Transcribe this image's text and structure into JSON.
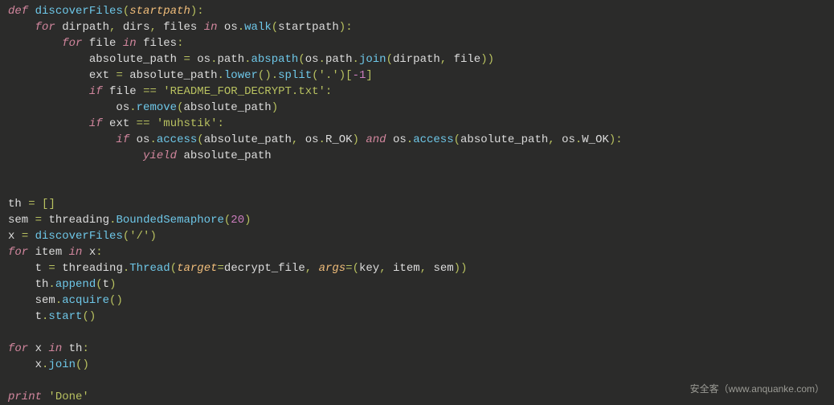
{
  "code": {
    "l1": {
      "def": "def",
      "fn": "discoverFiles",
      "lp": "(",
      "p": "startpath",
      "rp": ")",
      "colon": ":"
    },
    "l2": {
      "for": "for",
      "v1": "dirpath",
      "c1": ",",
      "v2": "dirs",
      "c2": ",",
      "v3": "files",
      "in": "in",
      "mod": "os",
      "dot": ".",
      "call": "walk",
      "lp": "(",
      "arg": "startpath",
      "rp": ")",
      "colon": ":"
    },
    "l3": {
      "for": "for",
      "v": "file",
      "in": "in",
      "seq": "files",
      "colon": ":"
    },
    "l4": {
      "lhs": "absolute_path",
      "eq": "=",
      "m1": "os",
      "d1": ".",
      "m2": "path",
      "d2": ".",
      "f1": "abspath",
      "lp1": "(",
      "m3": "os",
      "d3": ".",
      "m4": "path",
      "d4": ".",
      "f2": "join",
      "lp2": "(",
      "a1": "dirpath",
      "c": ",",
      "a2": "file",
      "rp2": ")",
      "rp1": ")"
    },
    "l5": {
      "lhs": "ext",
      "eq": "=",
      "base": "absolute_path",
      "d1": ".",
      "f1": "lower",
      "lp1": "(",
      "rp1": ")",
      "d2": ".",
      "f2": "split",
      "lp2": "(",
      "s": "'.'",
      "rp2": ")",
      "lb": "[",
      "idx": "-1",
      "rb": "]"
    },
    "l6": {
      "if": "if",
      "v": "file",
      "eq": "==",
      "s": "'README_FOR_DECRYPT.txt'",
      "colon": ":"
    },
    "l7": {
      "m": "os",
      "d": ".",
      "f": "remove",
      "lp": "(",
      "a": "absolute_path",
      "rp": ")"
    },
    "l8": {
      "if": "if",
      "v": "ext",
      "eq": "==",
      "s": "'muhstik'",
      "colon": ":"
    },
    "l9": {
      "if": "if",
      "m1": "os",
      "d1": ".",
      "f1": "access",
      "lp1": "(",
      "a1": "absolute_path",
      "c1": ",",
      "m2": "os",
      "d2": ".",
      "const1": "R_OK",
      "rp1": ")",
      "and": "and",
      "m3": "os",
      "d3": ".",
      "f2": "access",
      "lp2": "(",
      "a2": "absolute_path",
      "c2": ",",
      "m4": "os",
      "d4": ".",
      "const2": "W_OK",
      "rp2": ")",
      "colon": ":"
    },
    "l10": {
      "yield": "yield",
      "v": "absolute_path"
    },
    "l13": {
      "lhs": "th",
      "eq": "=",
      "lb": "[",
      "rb": "]"
    },
    "l14": {
      "lhs": "sem",
      "eq": "=",
      "m": "threading",
      "d": ".",
      "f": "BoundedSemaphore",
      "lp": "(",
      "n": "20",
      "rp": ")"
    },
    "l15": {
      "lhs": "x",
      "eq": "=",
      "f": "discoverFiles",
      "lp": "(",
      "s": "'/'",
      "rp": ")"
    },
    "l16": {
      "for": "for",
      "v": "item",
      "in": "in",
      "seq": "x",
      "colon": ":"
    },
    "l17": {
      "lhs": "t",
      "eq": "=",
      "m": "threading",
      "d": ".",
      "f": "Thread",
      "lp": "(",
      "k1": "target",
      "eq1": "=",
      "v1": "decrypt_file",
      "c1": ",",
      "k2": "args",
      "eq2": "=",
      "lp2": "(",
      "a1": "key",
      "c2": ",",
      "a2": "item",
      "c3": ",",
      "a3": "sem",
      "rp2": ")",
      "rp": ")"
    },
    "l18": {
      "obj": "th",
      "d": ".",
      "f": "append",
      "lp": "(",
      "a": "t",
      "rp": ")"
    },
    "l19": {
      "obj": "sem",
      "d": ".",
      "f": "acquire",
      "lp": "(",
      "rp": ")"
    },
    "l20": {
      "obj": "t",
      "d": ".",
      "f": "start",
      "lp": "(",
      "rp": ")"
    },
    "l22": {
      "for": "for",
      "v": "x",
      "in": "in",
      "seq": "th",
      "colon": ":"
    },
    "l23": {
      "obj": "x",
      "d": ".",
      "f": "join",
      "lp": "(",
      "rp": ")"
    },
    "l25": {
      "print": "print",
      "s": "'Done'"
    }
  },
  "watermark": "安全客（www.anquanke.com）"
}
